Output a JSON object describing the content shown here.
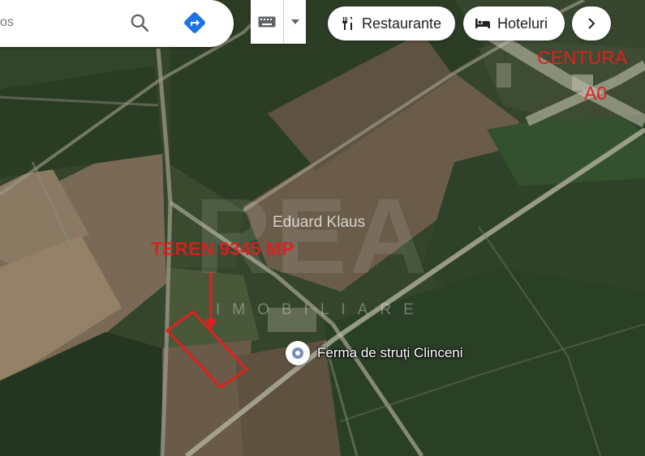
{
  "search": {
    "query": "os"
  },
  "chips": {
    "restaurants": "Restaurante",
    "hotels": "Hoteluri"
  },
  "icons": {
    "search": "search-icon",
    "directions": "directions-icon",
    "keyboard": "keyboard-icon",
    "dropdown": "caret-down-icon",
    "restaurant": "fork-knife-icon",
    "hotel": "bed-icon",
    "more": "chevron-right-icon",
    "place": "place-pin-icon"
  },
  "place": {
    "label": "Ferma de struți Clinceni"
  },
  "annotations": {
    "plot": "TEREN 9345 MP",
    "ring_road_line1": "CENTURA",
    "ring_road_line2": "A0"
  },
  "watermark": {
    "logo": "REA",
    "agent": "Eduard Klaus",
    "subtitle": "IMOBILIARE"
  },
  "colors": {
    "annotation": "#e01f1f",
    "directions": "#1a73e8"
  }
}
